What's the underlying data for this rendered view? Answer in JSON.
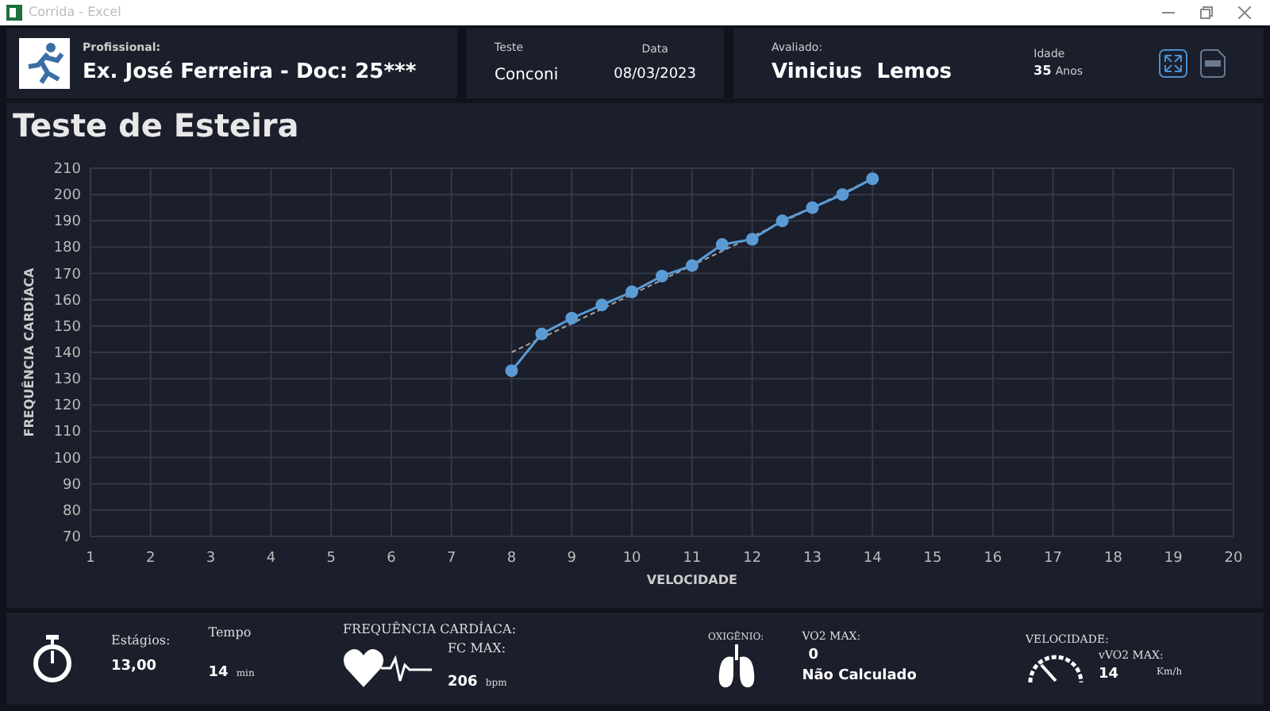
{
  "window": {
    "title": "Corrida - Excel"
  },
  "header": {
    "professional_label": "Profissional:",
    "professional": "Ex. José Ferreira - Doc: 25***",
    "test_label": "Teste",
    "test": "Conconi",
    "date_label": "Data",
    "date": "08/03/2023",
    "evaluated_label": "Avaliado:",
    "evaluated": "Vinicius  Lemos",
    "age_label": "Idade",
    "age": "35",
    "age_unit": "Anos"
  },
  "page_title": "Teste de Esteira",
  "chart_data": {
    "type": "line",
    "xlabel": "VELOCIDADE",
    "ylabel": "FREQUÊNCIA CARDÍACA",
    "x": [
      8,
      8.5,
      9,
      9.5,
      10,
      10.5,
      11,
      11.5,
      12,
      12.5,
      13,
      13.5,
      14
    ],
    "grid": true,
    "series": [
      {
        "color": "#5b9bd5",
        "marker": "circle",
        "line_style": "solid",
        "values": [
          133,
          147,
          153,
          158,
          163,
          169,
          173,
          181,
          183,
          190,
          195,
          200,
          206
        ]
      },
      {
        "color": "#a6a6a6",
        "marker": "none",
        "line_style": "dashed",
        "values": [
          140,
          145.5,
          151,
          156.5,
          162,
          167.5,
          173,
          178.5,
          184,
          189.5,
          195,
          200.5,
          206
        ]
      }
    ],
    "xlim": [
      1,
      20
    ],
    "ylim": [
      70,
      210
    ],
    "xticks": [
      1,
      2,
      3,
      4,
      5,
      6,
      7,
      8,
      9,
      10,
      11,
      12,
      13,
      14,
      15,
      16,
      17,
      18,
      19,
      20
    ],
    "yticks": [
      70,
      80,
      90,
      100,
      110,
      120,
      130,
      140,
      150,
      160,
      170,
      180,
      190,
      200,
      210
    ]
  },
  "footer": {
    "stages_label": "Estágios:",
    "stages": "13,00",
    "time_label": "Tempo",
    "time": "14",
    "time_unit": "min",
    "hr_title": "FREQUÊNCIA CARDÍACA:",
    "hr_label": "FC MAX:",
    "hr": "206",
    "hr_unit": "bpm",
    "oxygen_title": "OXIGÊNIO:",
    "vo2_label": "VO2 MAX:",
    "vo2": "0",
    "vo2_status": "Não Calculado",
    "speed_title": "VELOCIDADE:",
    "vvo2_label": "vVO2 MAX:",
    "vvo2": "14",
    "vvo2_unit": "Km/h"
  }
}
